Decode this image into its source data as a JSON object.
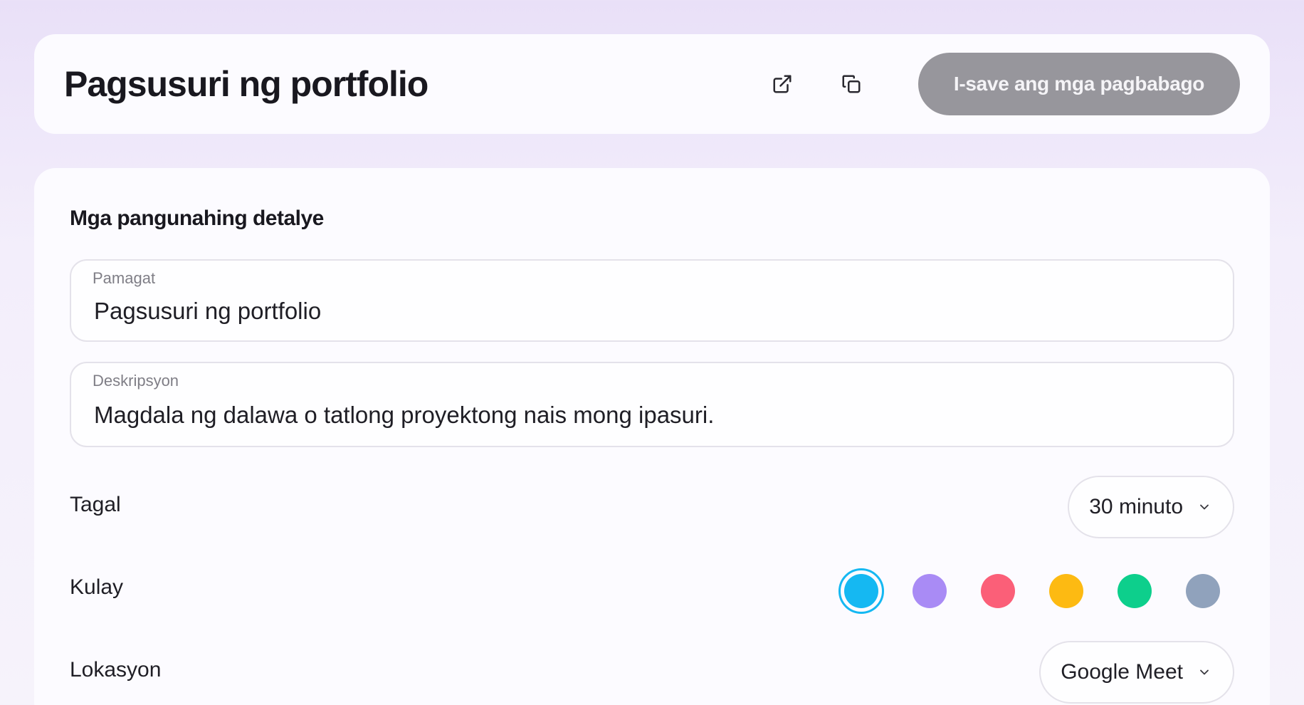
{
  "header": {
    "title": "Pagsusuri ng portfolio",
    "open_icon": "external-link-icon",
    "copy_icon": "copy-icon",
    "save_label": "I-save ang mga pagbabago"
  },
  "details": {
    "section_title": "Mga pangunahing detalye",
    "title_field": {
      "label": "Pamagat",
      "value": "Pagsusuri ng portfolio"
    },
    "description_field": {
      "label": "Deskripsyon",
      "value": "Magdala ng dalawa o tatlong proyektong nais mong ipasuri."
    },
    "duration": {
      "label": "Tagal",
      "value": "30 minuto"
    },
    "color": {
      "label": "Kulay",
      "options": [
        "#15b8f2",
        "#a98bf5",
        "#fb5f78",
        "#fdba12",
        "#0dcf8c",
        "#90a2bc"
      ],
      "selected_index": 0
    },
    "location": {
      "label": "Lokasyon",
      "value": "Google Meet"
    }
  }
}
